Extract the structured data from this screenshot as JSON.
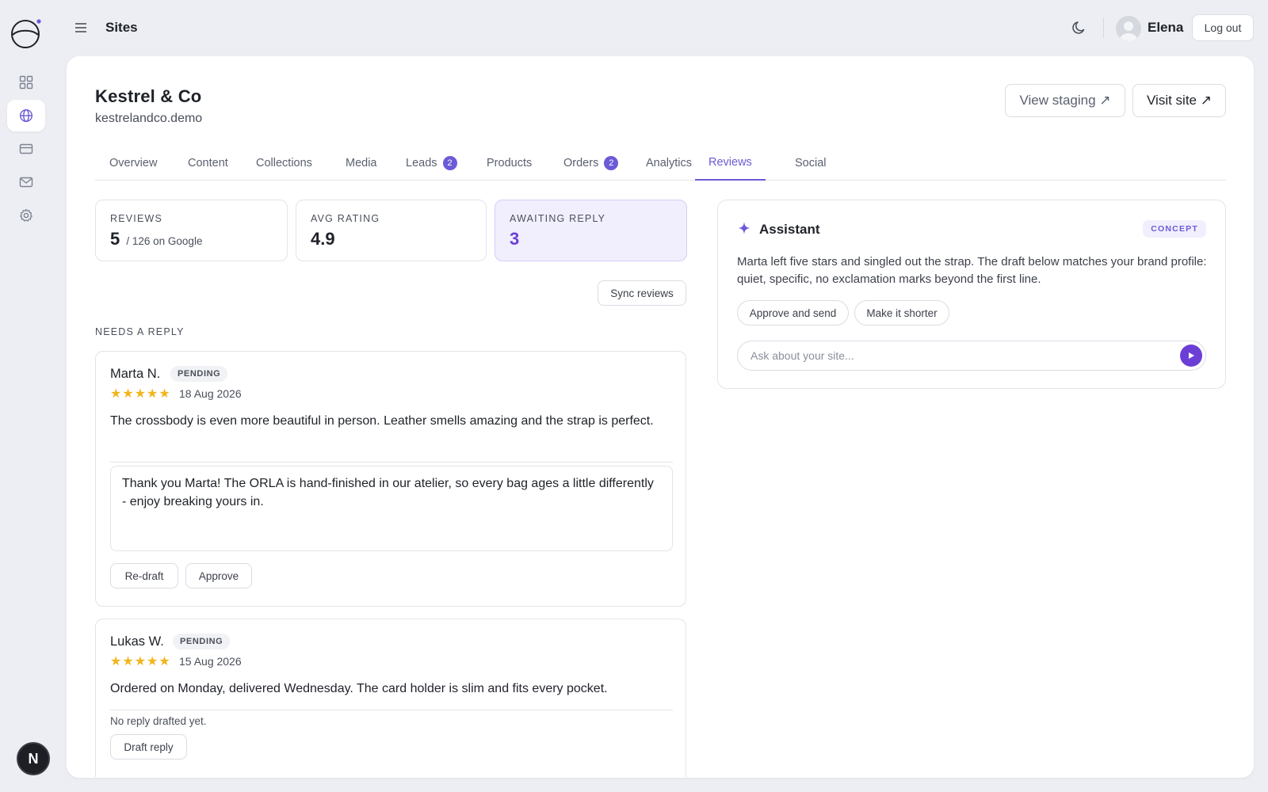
{
  "topbar": {
    "menu_icon": "hamburger-menu-icon",
    "title": "Sites",
    "theme_icon": "moon-icon",
    "user_name": "Elena",
    "logout_label": "Log out"
  },
  "rail": {
    "logo_icon": "planet-logo-icon",
    "items": [
      {
        "icon": "grid-icon",
        "active": false
      },
      {
        "icon": "globe-icon",
        "active": true
      },
      {
        "icon": "card-icon",
        "active": false
      },
      {
        "icon": "mail-icon",
        "active": false
      },
      {
        "icon": "gear-icon",
        "active": false
      }
    ],
    "bottom_badge": "N"
  },
  "site": {
    "name": "Kestrel & Co",
    "domain": "kestrelandco.demo",
    "staging_label": "View staging ↗",
    "visit_label": "Visit site ↗"
  },
  "tabs": [
    {
      "label": "Overview"
    },
    {
      "label": "Content"
    },
    {
      "label": "Collections"
    },
    {
      "label": "Media"
    },
    {
      "label": "Leads",
      "count": "2"
    },
    {
      "label": "Products"
    },
    {
      "label": "Orders",
      "count": "2"
    },
    {
      "label": "Analytics"
    },
    {
      "label": "Reviews",
      "active": true
    },
    {
      "label": "Social"
    }
  ],
  "stats": {
    "reviews": {
      "label": "REVIEWS",
      "value": "5",
      "sub": "/ 126 on Google"
    },
    "avg_rating": {
      "label": "AVG RATING",
      "value": "4.9"
    },
    "awaiting": {
      "label": "AWAITING REPLY",
      "value": "3"
    }
  },
  "sync_label": "Sync reviews",
  "section_label": "NEEDS A REPLY",
  "reviews": [
    {
      "name": "Marta N.",
      "status": "PENDING",
      "stars": "★★★★★",
      "date": "18 Aug 2026",
      "text": "The crossbody is even more beautiful in person. Leather smells amazing and the strap is perfect.",
      "reply": "Thank you Marta! The ORLA is hand-finished in our atelier, so every bag ages a little differently - enjoy breaking yours in.",
      "actions": [
        "Re-draft",
        "Approve"
      ]
    },
    {
      "name": "Lukas W.",
      "status": "PENDING",
      "stars": "★★★★★",
      "date": "15 Aug 2026",
      "text": "Ordered on Monday, delivered Wednesday. The card holder is slim and fits every pocket.",
      "no_reply": "No reply drafted yet.",
      "actions": [
        "Draft reply"
      ]
    }
  ],
  "assistant": {
    "title": "Assistant",
    "badge": "CONCEPT",
    "message": "Marta left five stars and singled out the strap. The draft below matches your brand profile: quiet, specific, no exclamation marks beyond the first line.",
    "suggestions": [
      "Approve and send",
      "Make it shorter"
    ],
    "input_placeholder": "Ask about your site...",
    "send_icon": "send-icon"
  },
  "colors": {
    "accent": "#6b5bd6",
    "accent_strong": "#6b3fd6",
    "star": "#f2b51c",
    "background": "#eceef3"
  }
}
